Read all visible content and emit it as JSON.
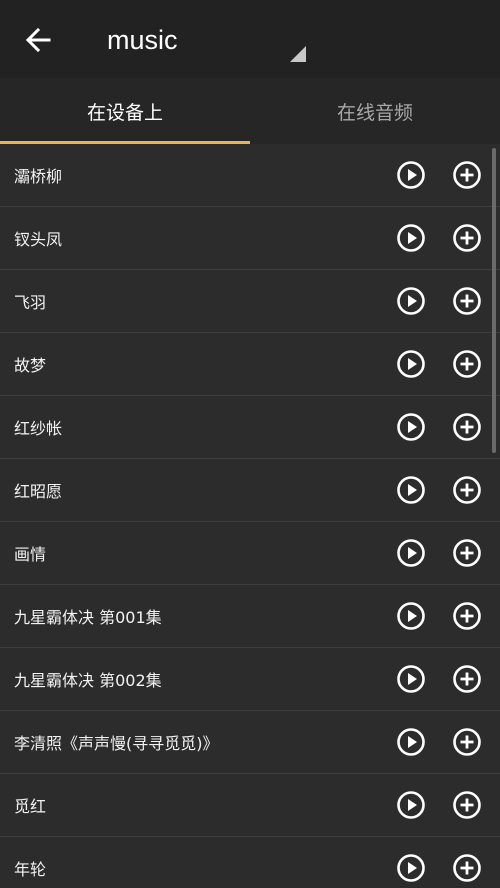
{
  "toolbar": {
    "back_icon": "arrow-left-icon",
    "title": "music",
    "dropdown_icon": "dropdown-triangle-icon"
  },
  "tabs": [
    {
      "label": "在设备上",
      "active": true
    },
    {
      "label": "在线音频",
      "active": false
    }
  ],
  "accent_color": "#f2b24a",
  "list": {
    "items": [
      {
        "title": "灞桥柳"
      },
      {
        "title": "钗头凤"
      },
      {
        "title": "飞羽"
      },
      {
        "title": "故梦"
      },
      {
        "title": "红纱帐"
      },
      {
        "title": "红昭愿"
      },
      {
        "title": "画情"
      },
      {
        "title": "九星霸体决 第001集"
      },
      {
        "title": "九星霸体决 第002集"
      },
      {
        "title": "李清照《声声慢(寻寻觅觅)》"
      },
      {
        "title": "觅红"
      },
      {
        "title": "年轮"
      }
    ],
    "play_icon": "play-circle-icon",
    "add_icon": "add-circle-icon"
  }
}
